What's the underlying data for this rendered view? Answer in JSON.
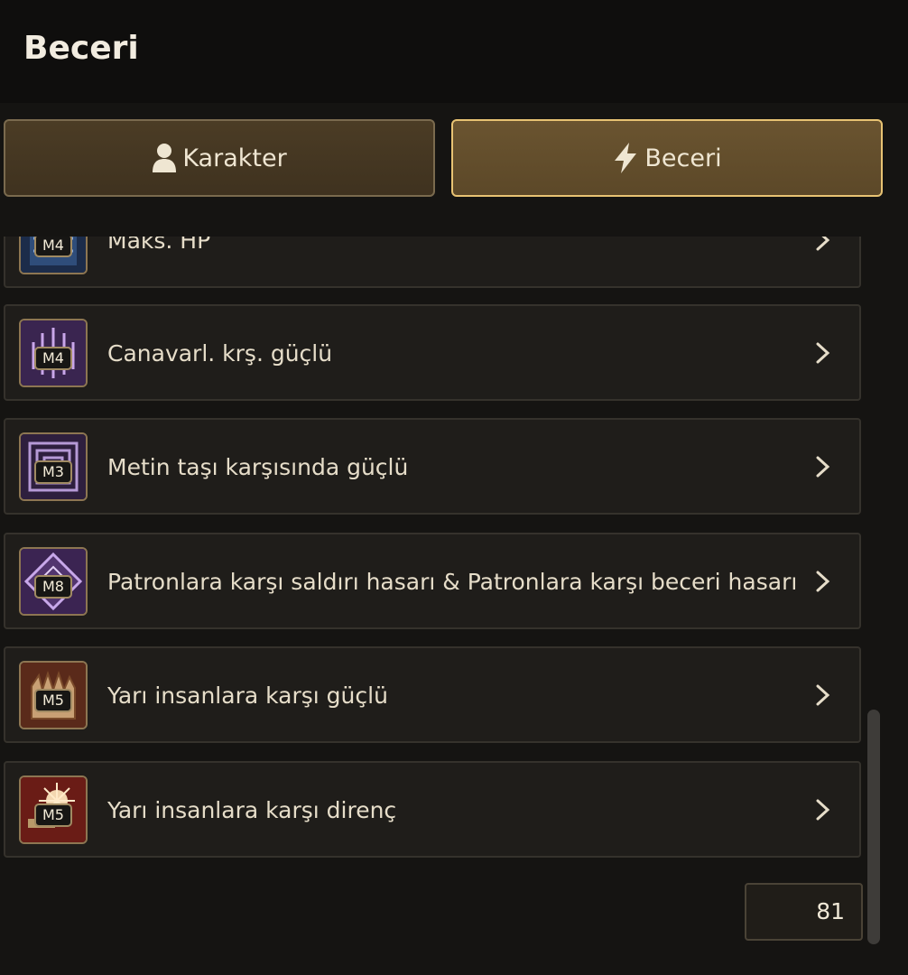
{
  "header": {
    "title": "Beceri"
  },
  "tabs": [
    {
      "label": "Karakter",
      "icon": "user-icon",
      "active": false
    },
    {
      "label": "Beceri",
      "icon": "lightning-icon",
      "active": true
    }
  ],
  "skills": [
    {
      "label": "Maks. HP",
      "level": "M4",
      "icon": "max-hp-skill-icon"
    },
    {
      "label": "Canavarl. krş. güçlü",
      "level": "M4",
      "icon": "monster-strength-skill-icon"
    },
    {
      "label": "Metin taşı karşısında güçlü",
      "level": "M3",
      "icon": "metin-stone-skill-icon"
    },
    {
      "label": "Patronlara karşı saldırı hasarı & Patronlara karşı beceri hasarı",
      "level": "M8",
      "icon": "boss-damage-skill-icon"
    },
    {
      "label": "Yarı insanlara karşı güçlü",
      "level": "M5",
      "icon": "half-human-strength-skill-icon"
    },
    {
      "label": "Yarı insanlara karşı direnç",
      "level": "M5",
      "icon": "half-human-resistance-skill-icon"
    }
  ],
  "footer": {
    "count": "81"
  },
  "colors": {
    "accent_border": "#e8c373",
    "tab_active_bg": "#6a5430",
    "tab_inactive_bg": "#4b3c25",
    "item_bg": "#1f1d1a"
  }
}
